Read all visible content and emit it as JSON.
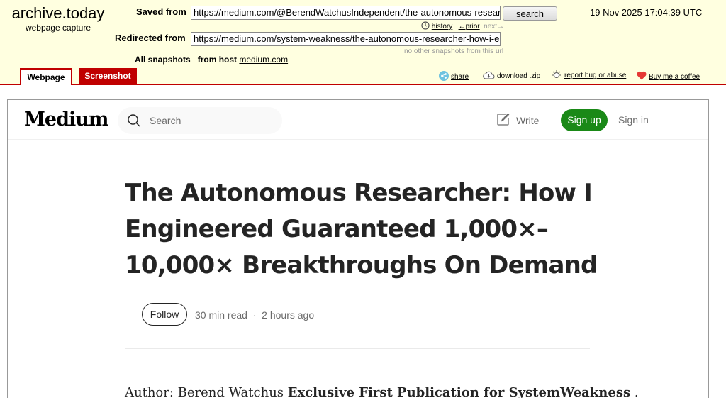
{
  "archive": {
    "brand_title": "archive.today",
    "brand_subtitle": "webpage capture",
    "saved_from_label": "Saved from",
    "saved_from_url": "https://medium.com/@BerendWatchusIndependent/the-autonomous-research",
    "search_button": "search",
    "timestamp": "19 Nov 2025 17:04:39 UTC",
    "history_link": "history",
    "prior_link": "←prior",
    "next_link": "next→",
    "redirected_from_label": "Redirected from",
    "redirected_from_url": "https://medium.com/system-weakness/the-autonomous-researcher-how-i-en",
    "no_other_snapshots": "no other snapshots from this url",
    "all_snapshots_label": "All snapshots",
    "from_host_label": "from host",
    "host_link": "medium.com",
    "tabs": {
      "webpage": "Webpage",
      "screenshot": "Screenshot"
    },
    "toolbar": {
      "share": "share",
      "download": "download .zip",
      "report": "report bug or abuse",
      "coffee": "Buy me a coffee"
    },
    "colors": {
      "background": "#ffffe0",
      "accent": "#c00000"
    }
  },
  "medium": {
    "logo": "Medium",
    "search_placeholder": "Search",
    "write_label": "Write",
    "signup_label": "Sign up",
    "signin_label": "Sign in",
    "article_title": "The Autonomous Researcher: How I Engineered Guaranteed 1,000×–10,000× Breakthroughs On Demand",
    "follow_label": "Follow",
    "read_time": "30 min read",
    "separator": "·",
    "posted": "2 hours ago",
    "author_prefix": "Author: Berend Watchus ",
    "author_bold": "Exclusive First Publication for SystemWeakness",
    "author_suffix": " .",
    "colors": {
      "signup": "#1a8917",
      "text": "#242424",
      "muted": "#6b6b6b"
    }
  }
}
